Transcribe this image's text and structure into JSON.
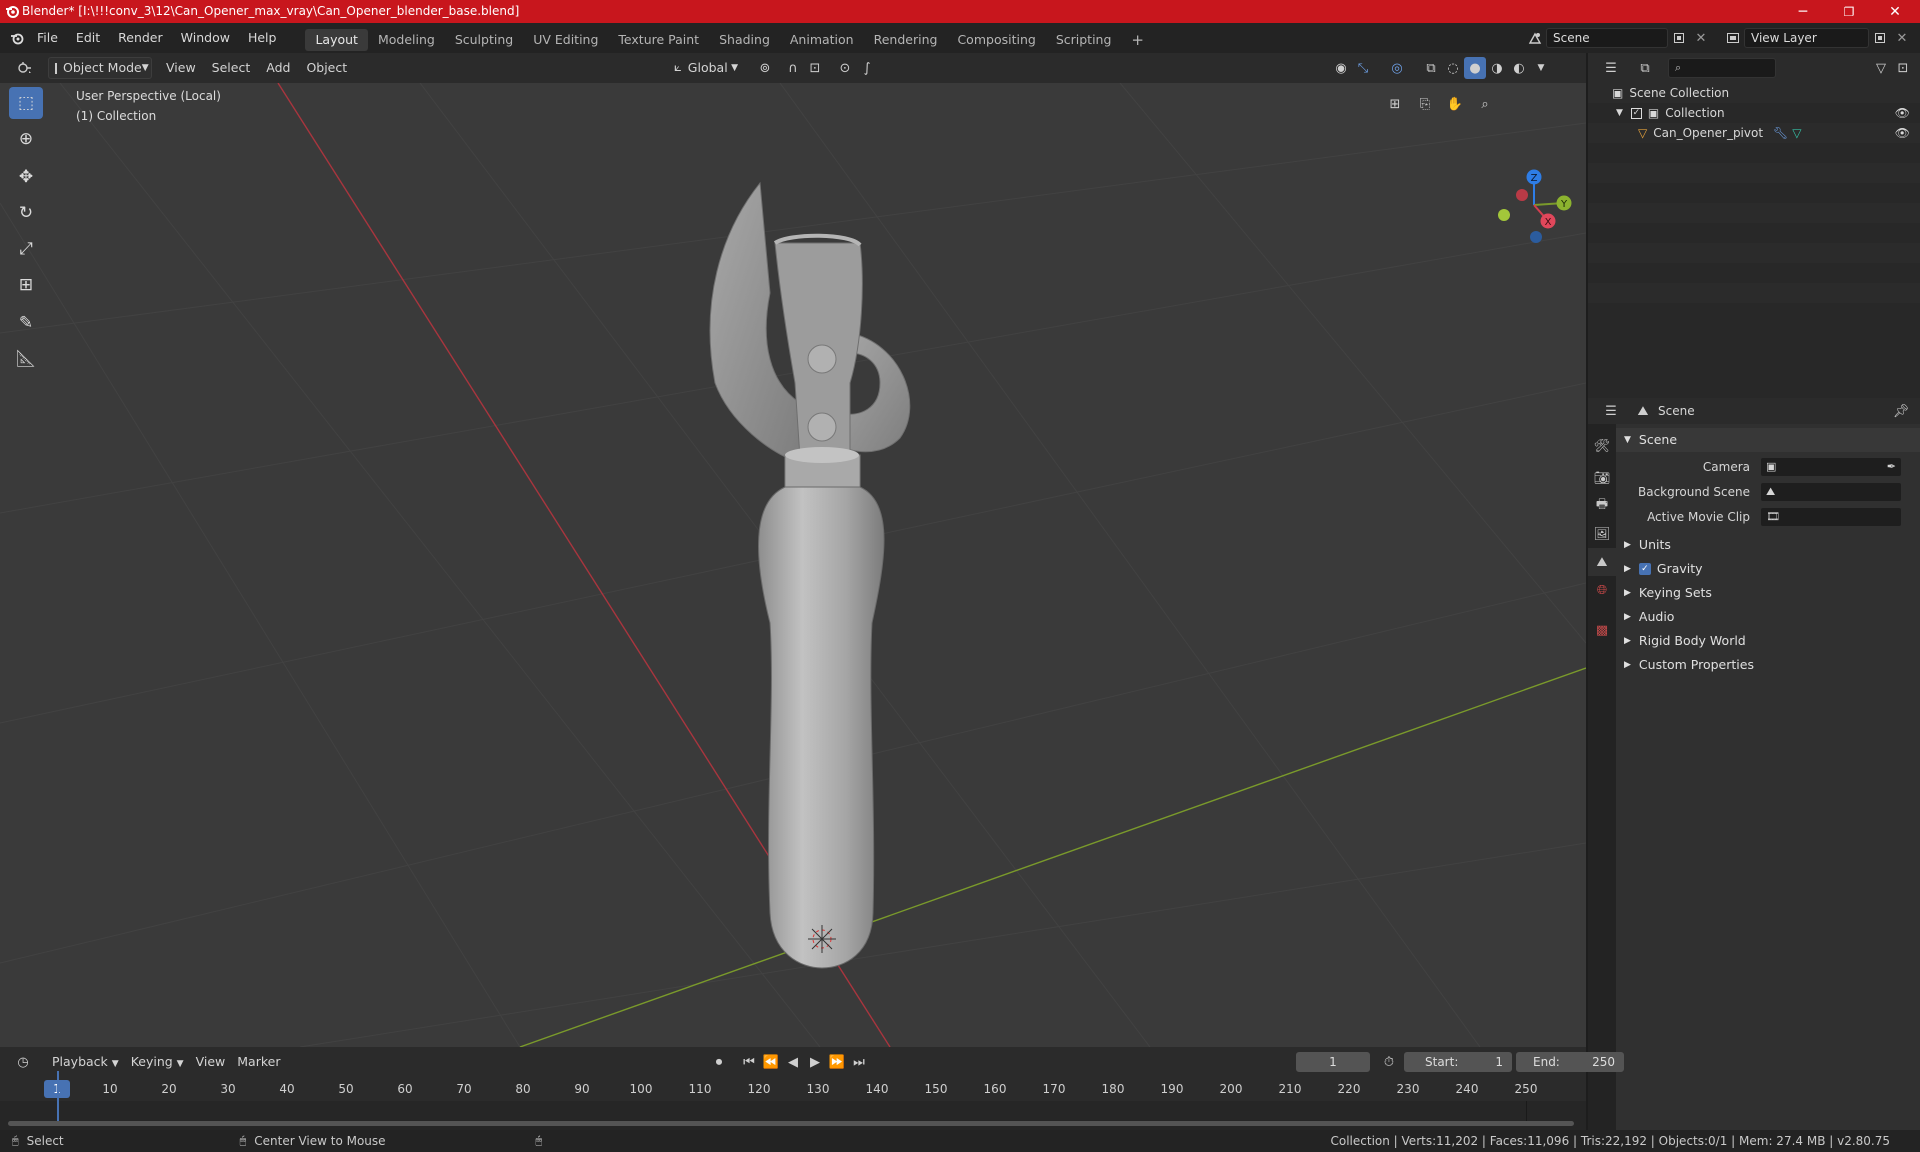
{
  "window": {
    "title": "Blender* [I:\\!!!conv_3\\12\\Can_Opener_max_vray\\Can_Opener_blender_base.blend]",
    "minimize": "─",
    "maximize": "❐",
    "close": "✕"
  },
  "menu": {
    "items": [
      "File",
      "Edit",
      "Render",
      "Window",
      "Help"
    ]
  },
  "workspaces": {
    "tabs": [
      "Layout",
      "Modeling",
      "Sculpting",
      "UV Editing",
      "Texture Paint",
      "Shading",
      "Animation",
      "Rendering",
      "Compositing",
      "Scripting"
    ],
    "active": "Layout",
    "add": "+"
  },
  "scene_selector": {
    "value": "Scene"
  },
  "viewlayer_selector": {
    "value": "View Layer"
  },
  "viewport_header": {
    "mode": "Object Mode",
    "view": "View",
    "select": "Select",
    "add": "Add",
    "object": "Object",
    "transform_orientation": "Global"
  },
  "viewport": {
    "perspective": "User Perspective (Local)",
    "collection": "(1) Collection",
    "gizmo": {
      "x": "X",
      "y": "Y",
      "z": "Z"
    }
  },
  "outliner": {
    "rows": [
      {
        "label": "Scene Collection"
      },
      {
        "label": "Collection"
      },
      {
        "label": "Can_Opener_pivot"
      }
    ]
  },
  "properties": {
    "header": "Scene",
    "panel": "Scene",
    "fields": [
      {
        "label": "Camera"
      },
      {
        "label": "Background Scene"
      },
      {
        "label": "Active Movie Clip"
      }
    ],
    "subpanels": [
      "Units",
      "Gravity",
      "Keying Sets",
      "Audio",
      "Rigid Body World",
      "Custom Properties"
    ]
  },
  "timeline": {
    "playback": "Playback",
    "keying": "Keying",
    "view": "View",
    "marker": "Marker",
    "current_frame": "1",
    "start_label": "Start:",
    "start": "1",
    "end_label": "End:",
    "end": "250",
    "ticks": [
      "1",
      "10",
      "20",
      "30",
      "40",
      "50",
      "60",
      "70",
      "80",
      "90",
      "100",
      "110",
      "120",
      "130",
      "140",
      "150",
      "160",
      "170",
      "180",
      "190",
      "200",
      "210",
      "220",
      "230",
      "240",
      "250"
    ]
  },
  "statusbar": {
    "select": "Select",
    "center": "Center View to Mouse",
    "stats": "Collection | Verts:11,202 | Faces:11,096 | Tris:22,192 | Objects:0/1 | Mem: 27.4 MB | v2.80.75"
  },
  "colors": {
    "titlebar": "#c8161d",
    "accent": "#4772b3",
    "x_axis": "#a8353e",
    "y_axis": "#7a9a2b"
  }
}
